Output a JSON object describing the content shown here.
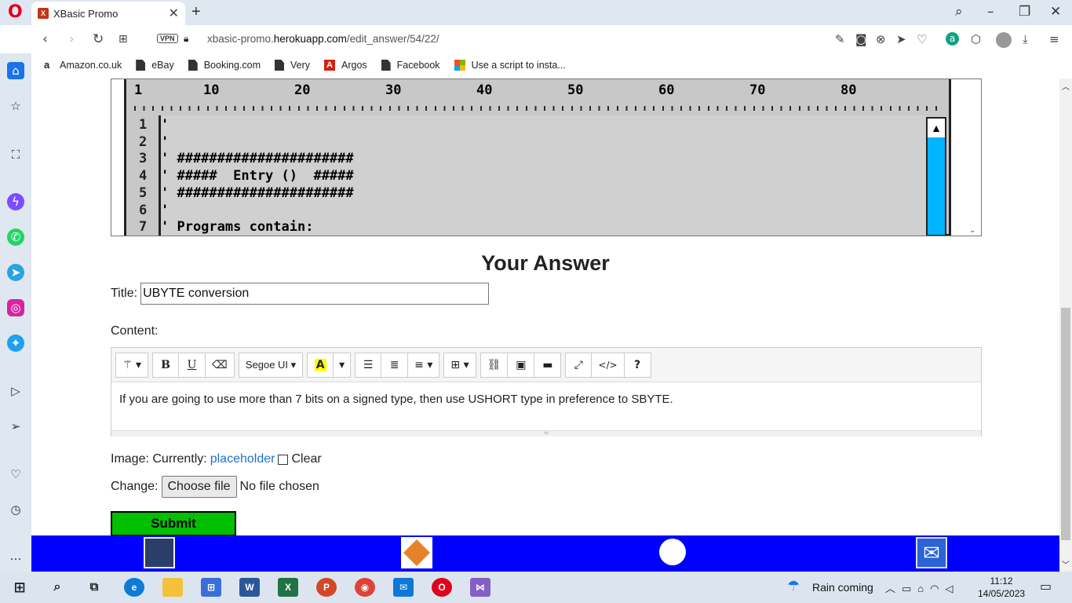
{
  "browser": {
    "tab_title": "XBasic Promo",
    "url_host": "xbasic-promo.",
    "url_domain": "herokuapp.com",
    "url_path": "/edit_answer/54/22/",
    "vpn_label": "VPN"
  },
  "bookmarks": [
    {
      "label": "Amazon.co.uk",
      "icon": "amazon-icon"
    },
    {
      "label": "eBay",
      "icon": "page-icon"
    },
    {
      "label": "Booking.com",
      "icon": "page-icon"
    },
    {
      "label": "Very",
      "icon": "page-icon"
    },
    {
      "label": "Argos",
      "icon": "argos-icon"
    },
    {
      "label": "Facebook",
      "icon": "page-icon"
    },
    {
      "label": "Use a script to insta...",
      "icon": "microsoft-icon"
    }
  ],
  "screenshot": {
    "ruler_numbers": [
      "1",
      "10",
      "20",
      "30",
      "40",
      "50",
      "60",
      "70",
      "80"
    ],
    "line_numbers": [
      "1",
      "2",
      "3",
      "4",
      "5",
      "6",
      "7"
    ],
    "code_lines": [
      "'",
      "'",
      "' ######################",
      "' #####  Entry ()  #####",
      "' ######################",
      "'",
      "' Programs contain:"
    ]
  },
  "form": {
    "heading": "Your Answer",
    "title_label": "Title:",
    "title_value": "UBYTE conversion",
    "content_label": "Content:",
    "font_name": "Segoe UI",
    "content_text": "If you are going to use more than 7 bits on a signed type, then use USHORT type in preference to SBYTE.",
    "image_label": "Image: Currently:",
    "image_link": "placeholder",
    "clear_label": "Clear",
    "change_label": "Change:",
    "choose_file": "Choose file",
    "no_file": "No file chosen",
    "submit": "Submit"
  },
  "taskbar": {
    "weather": "Rain coming",
    "time": "11:12",
    "date": "14/05/2023"
  },
  "colors": {
    "submit_bg": "#00c000",
    "footer_bg": "#0000ff",
    "link": "#1a73c8"
  }
}
